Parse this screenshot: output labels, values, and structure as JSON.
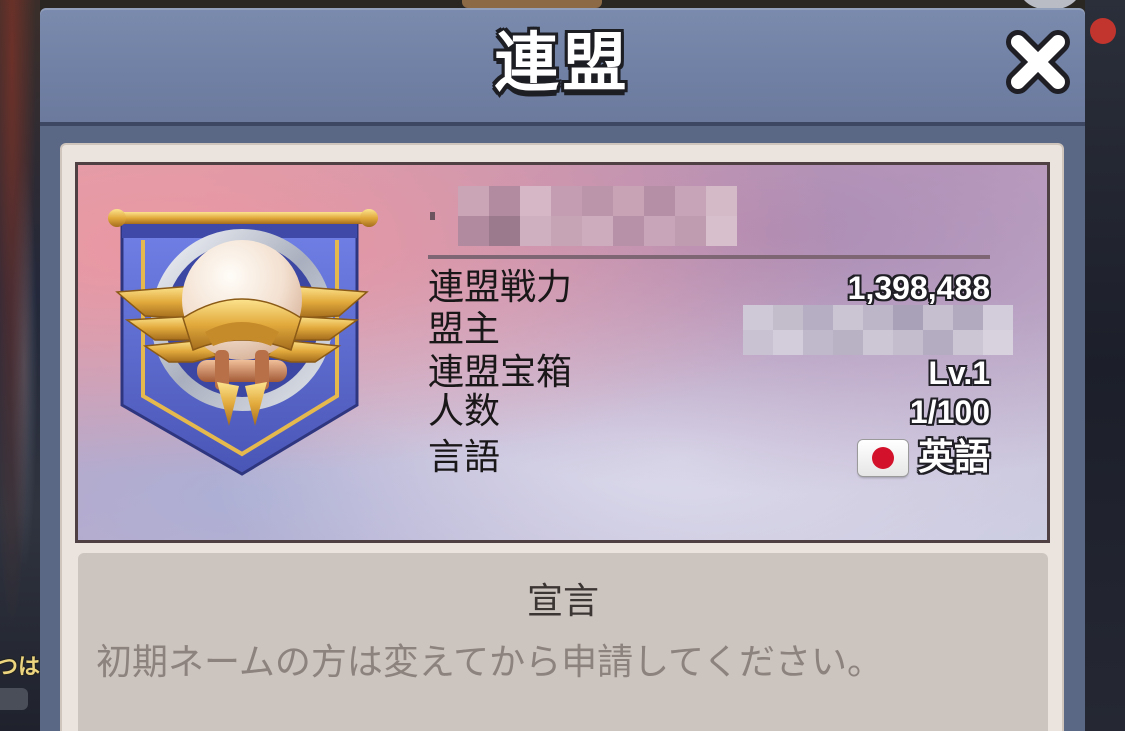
{
  "dialog": {
    "title": "連盟",
    "close_icon": "close-icon"
  },
  "alliance": {
    "emblem_icon": "alliance-banner-emblem-icon",
    "stats": [
      {
        "label": "連盟戦力",
        "value": "1,398,488"
      },
      {
        "label": "盟主"
      },
      {
        "label": "連盟宝箱",
        "value": "Lv.1"
      },
      {
        "label": "人数",
        "value": "1/100"
      },
      {
        "label": "言語",
        "value": "英語",
        "flag_icon": "japan-flag-icon"
      }
    ]
  },
  "declaration": {
    "heading": "宣言",
    "text": "初期ネームの方は変えてから申請してください。"
  },
  "background": {
    "edge_text": "つは"
  },
  "colors": {
    "header": "#7282a6",
    "panel": "#ebe4de",
    "card_border": "#4e4043",
    "declaration_box": "#ccc4be",
    "value_text": "#ffffff",
    "flag_red": "#d3112a"
  }
}
